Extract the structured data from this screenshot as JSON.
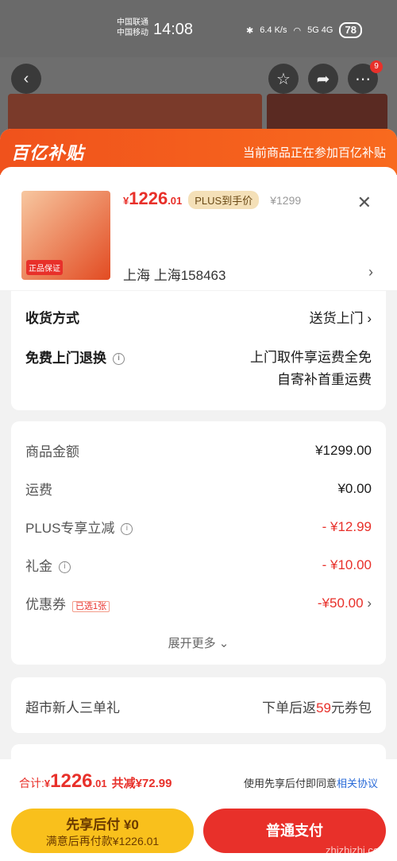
{
  "status_bar": {
    "carrier1": "中国联通",
    "carrier2": "中国移动",
    "time": "14:08",
    "speed": "6.4 K/s",
    "signal": "5G 4G",
    "battery": "78"
  },
  "sheet": {
    "brand": "百亿补贴",
    "note": "当前商品正在参加百亿补贴"
  },
  "product": {
    "price_symbol": "¥",
    "price_int": "1226",
    "price_dec": ".01",
    "plus_badge": "PLUS到手价",
    "original_price": "¥1299",
    "thumb_tag": "正品保证",
    "address": "上海  上海158463"
  },
  "delivery": {
    "method_label": "收货方式",
    "method_value": "送货上门",
    "return_label": "免费上门退换",
    "return_line1": "上门取件享运费全免",
    "return_line2": "自寄补首重运费"
  },
  "fees": {
    "goods_label": "商品金额",
    "goods_value": "¥1299.00",
    "shipping_label": "运费",
    "shipping_value": "¥0.00",
    "plus_label": "PLUS专享立减",
    "plus_value": "- ¥12.99",
    "gift_label": "礼金",
    "gift_value": "- ¥10.00",
    "coupon_label": "优惠券",
    "coupon_tag": "已选1张",
    "coupon_value": "-¥50.00",
    "more": "展开更多"
  },
  "new_user": {
    "label": "超市新人三单礼",
    "value_pre": "下单后返",
    "value_num": "59",
    "value_post": "元券包"
  },
  "bottom": {
    "total_label": "合计: ",
    "total_symbol": "¥",
    "total_int": "1226",
    "total_dec": ".01",
    "total_cut": "共减¥72.99",
    "agree_text": "使用先享后付即同意",
    "agree_link": "相关协议",
    "later_line1": "先享后付 ¥0",
    "later_line2": "满意后再付款¥1226.01",
    "pay_label": "普通支付",
    "watermark": "zhizhizhi.com"
  },
  "colors": {
    "accent": "#e8302a",
    "brand_orange": "#f0521c",
    "later_yellow": "#f9c01c"
  }
}
